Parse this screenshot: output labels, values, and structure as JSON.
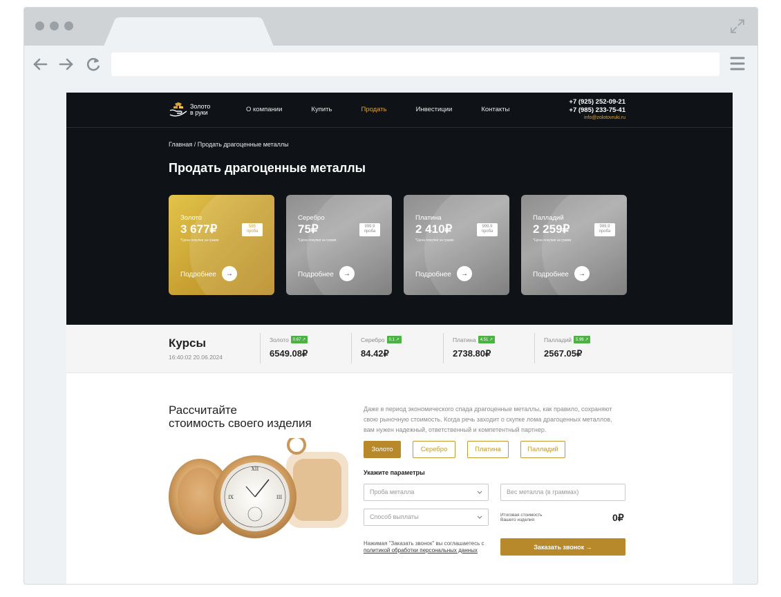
{
  "header": {
    "logo_line1": "Золото",
    "logo_line2": "в руки",
    "nav": [
      "О компании",
      "Купить",
      "Продать",
      "Инвестиции",
      "Контакты"
    ],
    "active_nav": "Продать",
    "phone1": "+7 (925) 252-09-21",
    "phone2": "+7 (985) 233-75-41",
    "email": "info@zolotovruki.ru"
  },
  "breadcrumb": "Главная / Продать драгоценные металлы",
  "page_title": "Продать драгоценные металлы",
  "cards": [
    {
      "name": "Золото",
      "price": "3 677₽",
      "note": "*Цена покупки за грамм",
      "probe_num": "585",
      "probe_label": "проба",
      "more": "Подробнее"
    },
    {
      "name": "Серебро",
      "price": "75₽",
      "note": "*Цена покупки за грамм",
      "probe_num": "999.9",
      "probe_label": "проба",
      "more": "Подробнее"
    },
    {
      "name": "Платина",
      "price": "2 410₽",
      "note": "*Цена покупки за грамм",
      "probe_num": "999.9",
      "probe_label": "проба",
      "more": "Подробнее"
    },
    {
      "name": "Палладий",
      "price": "2 259₽",
      "note": "*Цена покупки за грамм",
      "probe_num": "999.9",
      "probe_label": "проба",
      "more": "Подробнее"
    }
  ],
  "rates": {
    "title": "Курсы",
    "time": "16:40:02 20.06.2024",
    "items": [
      {
        "name": "Золото",
        "change": "0.67 ↗",
        "value": "6549.08₽"
      },
      {
        "name": "Серебро",
        "change": "0.1 ↗",
        "value": "84.42₽"
      },
      {
        "name": "Платина",
        "change": "4.51 ↗",
        "value": "2738.80₽"
      },
      {
        "name": "Палладий",
        "change": "5.96 ↗",
        "value": "2567.05₽"
      }
    ]
  },
  "calc": {
    "title_line1": "Рассчитайте",
    "title_line2": "стоимость своего изделия",
    "description": "Даже в период экономического спада драгоценные металлы, как правило, сохраняют свою рыночную стоимость. Когда речь заходит о скупке лома драгоценных металлов, вам нужен надежный, ответственный и компетентный партнер.",
    "tabs": [
      "Золото",
      "Серебро",
      "Платина",
      "Палладий"
    ],
    "params_label": "Укажите параметры",
    "probe_placeholder": "Проба металла",
    "weight_placeholder": "Вес металла (в граммах)",
    "payout_placeholder": "Способ выплаты",
    "total_label_1": "Итоговая стоимость",
    "total_label_2": "Вашего изделия",
    "total_value": "0₽",
    "agree_text": "Нажимая \"Заказать звонок\" вы соглашаетесь с",
    "agree_link": "политикой обработки персональных данных",
    "order_button": "Заказать звонок →"
  },
  "colors": {
    "accent": "#b8892a",
    "hero_bg": "#0f1317",
    "badge_green": "#4cb243"
  }
}
